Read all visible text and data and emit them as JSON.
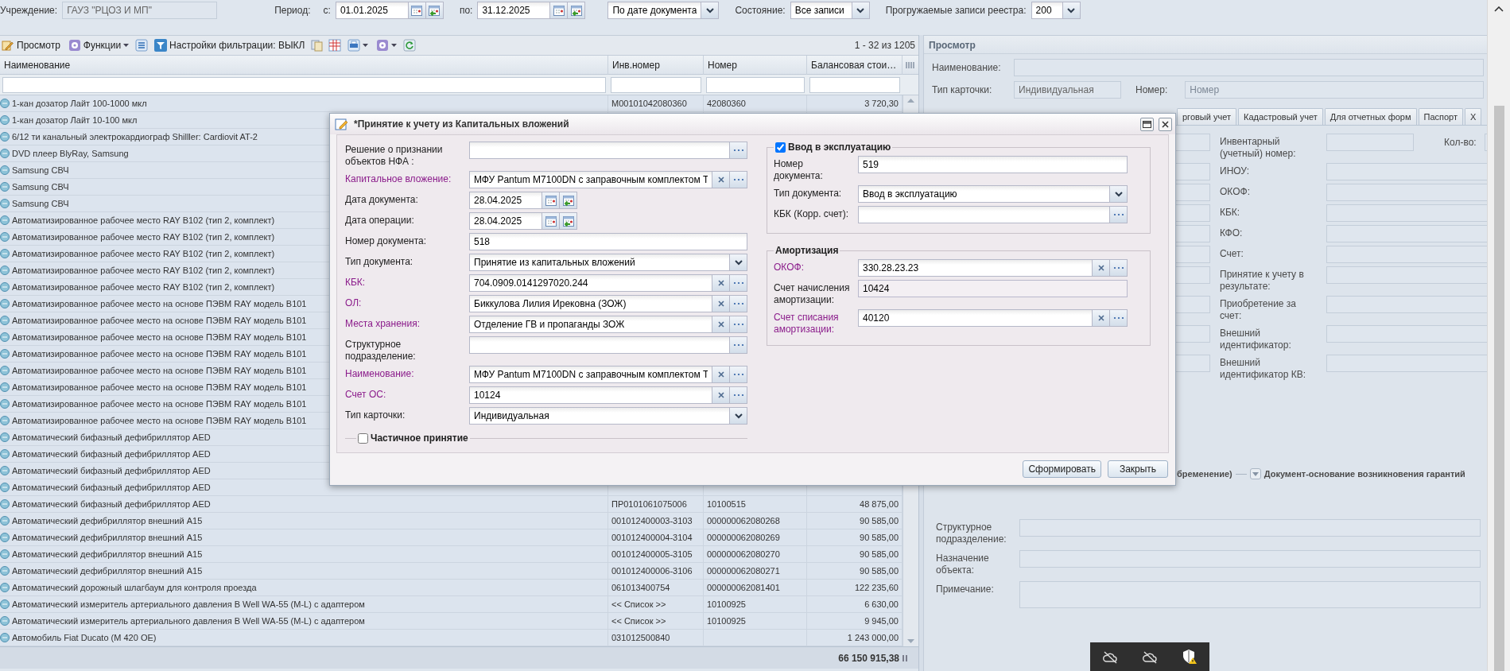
{
  "filter_bar": {
    "institution_label": "Учреждение:",
    "institution": "ГАУЗ \"РЦОЗ И МП\"",
    "period_label": "Период:",
    "from_label": "с:",
    "from": "01.01.2025",
    "to_label": "по:",
    "to": "31.12.2025",
    "date_mode": "По дате документа",
    "state_label": "Состояние:",
    "state": "Все записи",
    "records_label": "Прогружаемые записи реестра:",
    "records": "200"
  },
  "toolbar": {
    "view": "Просмотр",
    "functions": "Функции",
    "filter": "Настройки фильтрации: ВЫКЛ",
    "pager": "1 - 32 из 1205"
  },
  "grid": {
    "columns": [
      "Наименование",
      "Инв.номер",
      "Номер",
      "Балансовая стои…"
    ],
    "rows": [
      {
        "name": "1-кан дозатор Лайт 100-1000 мкл",
        "inventory_number": "M00101042080360",
        "number": "42080360",
        "book_value": "3 720,30"
      },
      {
        "name": "1-кан дозатор Лайт 10-100 мкл"
      },
      {
        "name": "6/12 ти канальный электрокардиограф Shilller: Cardiovit AT-2"
      },
      {
        "name": "DVD плеер BlyRay, Samsung"
      },
      {
        "name": "Samsung СВЧ"
      },
      {
        "name": "Samsung СВЧ"
      },
      {
        "name": "Samsung СВЧ"
      },
      {
        "name": "Автоматизированное рабочее место RAY B102 (тип 2, комплект)"
      },
      {
        "name": "Автоматизированное рабочее место RAY B102 (тип 2, комплект)"
      },
      {
        "name": "Автоматизированное рабочее место RAY B102 (тип 2, комплект)"
      },
      {
        "name": "Автоматизированное рабочее место RAY B102 (тип 2, комплект)"
      },
      {
        "name": "Автоматизированное рабочее место RAY B102 (тип 2, комплект)"
      },
      {
        "name": "Автоматизированное рабочее место на основе ПЭВМ RAY модель B101"
      },
      {
        "name": "Автоматизированное рабочее место на основе ПЭВМ RAY модель B101"
      },
      {
        "name": "Автоматизированное рабочее место на основе ПЭВМ RAY модель B101"
      },
      {
        "name": "Автоматизированное рабочее место на основе ПЭВМ RAY модель B101"
      },
      {
        "name": "Автоматизированное рабочее место на основе ПЭВМ RAY модель B101"
      },
      {
        "name": "Автоматизированное рабочее место на основе ПЭВМ RAY модель B101"
      },
      {
        "name": "Автоматизированное рабочее место на основе ПЭВМ RAY модель B101"
      },
      {
        "name": "Автоматизированное рабочее место на основе ПЭВМ RAY модель B101"
      },
      {
        "name": "Автоматический бифазный дефибриллятор AED"
      },
      {
        "name": "Автоматический бифазный дефибриллятор AED"
      },
      {
        "name": "Автоматический бифазный дефибриллятор AED"
      },
      {
        "name": "Автоматический бифазный дефибриллятор AED"
      },
      {
        "name": "Автоматический бифазный дефибриллятор AED",
        "inventory_number": "ПР0101061075006",
        "number": "10100515",
        "book_value": "48 875,00"
      },
      {
        "name": "Автоматический дефибриллятор внешний А15",
        "inventory_number": "001012400003-3103",
        "number": "000000062080268",
        "book_value": "90 585,00"
      },
      {
        "name": "Автоматический дефибриллятор внешний А15",
        "inventory_number": "001012400004-3104",
        "number": "000000062080269",
        "book_value": "90 585,00"
      },
      {
        "name": "Автоматический дефибриллятор внешний А15",
        "inventory_number": "001012400005-3105",
        "number": "000000062080270",
        "book_value": "90 585,00"
      },
      {
        "name": "Автоматический дефибриллятор внешний А15",
        "inventory_number": "001012400006-3106",
        "number": "000000062080271",
        "book_value": "90 585,00"
      },
      {
        "name": "Автоматический дорожный шлагбаум для контроля проезда",
        "inventory_number": "061013400754",
        "number": "000000062081401",
        "book_value": "122 235,60"
      },
      {
        "name": "Автоматический измеритель артериального давления B Well WA-55 (M-L) с адаптером",
        "inventory_number": "<< Список >>",
        "number": "10100925",
        "book_value": "6 630,00"
      },
      {
        "name": "Автоматический измеритель артериального давления B Well WA-55 (M-L) с адаптером",
        "inventory_number": "<< Список >>",
        "number": "10100925",
        "book_value": "9 945,00"
      },
      {
        "name": "Автомобиль Fiat Ducato (М 420 ОЕ)",
        "inventory_number": "031012500840",
        "book_value": "1 243 000,00"
      }
    ],
    "total": "66 150 915,38"
  },
  "view_panel": {
    "title": "Просмотр",
    "name_label": "Наименование:",
    "card_type_label": "Тип карточки:",
    "card_type": "Индивидуальная",
    "number_label": "Номер:",
    "number_placeholder": "Номер",
    "tabs": [
      {
        "label": "рговый учет",
        "selected": false
      },
      {
        "label": "Кадастровый учет",
        "selected": false
      },
      {
        "label": "Для отчетных форм",
        "selected": false
      },
      {
        "label": "Паспорт",
        "selected": false
      },
      {
        "label": "Х",
        "selected": false
      }
    ],
    "fields": [
      {
        "label": "Инвентарный (учетный) номер:"
      },
      {
        "label": "ИНОУ:"
      },
      {
        "label": "ОКОФ:"
      },
      {
        "label": "КБК:"
      },
      {
        "label": "КФО:"
      },
      {
        "label": "Счет:"
      },
      {
        "label": "Принятие к учету в результате:"
      },
      {
        "label": "Приобретение за счет:"
      },
      {
        "label": "Внешний идентификатор:"
      },
      {
        "label": "Внешний идентификатор КВ:"
      }
    ],
    "quantity_label": "Кол-во:",
    "sections": [
      "бременение)",
      "Документ-основание возникновения гарантий"
    ],
    "bottom_fields": [
      {
        "label": "Структурное подразделение:",
        "kind": "input"
      },
      {
        "label": "Назначение объекта:",
        "kind": "input"
      },
      {
        "label": "Примечание:",
        "kind": "textarea"
      }
    ]
  },
  "dialog": {
    "title": "*Принятие к учету из Капитальных вложений",
    "fields": [
      {
        "label": "Решение о признании объектов НФА :",
        "kind": "lookup",
        "required": false
      },
      {
        "label": "Капитальное вложение:",
        "kind": "clearable",
        "required": true,
        "value": "МФУ Pantum M7100DN с заправочным комплектом T"
      },
      {
        "label": "Дата документа:",
        "kind": "date",
        "required": false,
        "value": "28.04.2025"
      },
      {
        "label": "Дата операции:",
        "kind": "date",
        "required": false,
        "value": "28.04.2025"
      },
      {
        "label": "Номер документа:",
        "kind": "text",
        "required": false,
        "value": "518"
      },
      {
        "label": "Тип документа:",
        "kind": "select",
        "required": false,
        "value": "Принятие из капитальных вложений"
      },
      {
        "label": "КБК:",
        "kind": "clearable",
        "required": true,
        "value": "704.0909.0141297020.244"
      },
      {
        "label": "ОЛ:",
        "kind": "clearable",
        "required": true,
        "value": "Биккулова Лилия Ирековна (ЗОЖ)"
      },
      {
        "label": "Места хранения:",
        "kind": "clearable",
        "required": true,
        "value": "Отделение ГВ и пропаганды ЗОЖ"
      },
      {
        "label": "Структурное подразделение:",
        "kind": "lookup",
        "required": false
      },
      {
        "label": "Наименование:",
        "kind": "clearable",
        "required": true,
        "value": "МФУ Pantum M7100DN с заправочным комплектом T"
      },
      {
        "label": "Счет ОС:",
        "kind": "clearable",
        "required": true,
        "value": "10124"
      },
      {
        "label": "Тип карточки:",
        "kind": "select",
        "required": false,
        "value": "Индивидуальная"
      }
    ],
    "partial": {
      "label": "Частичное принятие",
      "checked": false
    },
    "commissioning": {
      "label": "Ввод в эксплуатацию",
      "checked": true,
      "fields": [
        {
          "label": "Номер документа:",
          "kind": "text",
          "required": false,
          "value": "519"
        },
        {
          "label": "Тип документа:",
          "kind": "select",
          "required": false,
          "value": "Ввод в эксплуатацию"
        },
        {
          "label": "КБК (Корр. счет):",
          "kind": "lookup",
          "required": false
        }
      ]
    },
    "depreciation": {
      "title": "Амортизация",
      "fields": [
        {
          "label": "ОКОФ:",
          "kind": "clearable",
          "required": true,
          "value": "330.28.23.23"
        },
        {
          "label": "Счет начисления амортизации:",
          "kind": "readonly",
          "required": false,
          "value": "10424"
        },
        {
          "label": "Счет списания амортизации:",
          "kind": "clearable",
          "required": true,
          "value": "40120"
        }
      ]
    },
    "buttons": [
      "Сформировать",
      "Закрыть"
    ]
  }
}
